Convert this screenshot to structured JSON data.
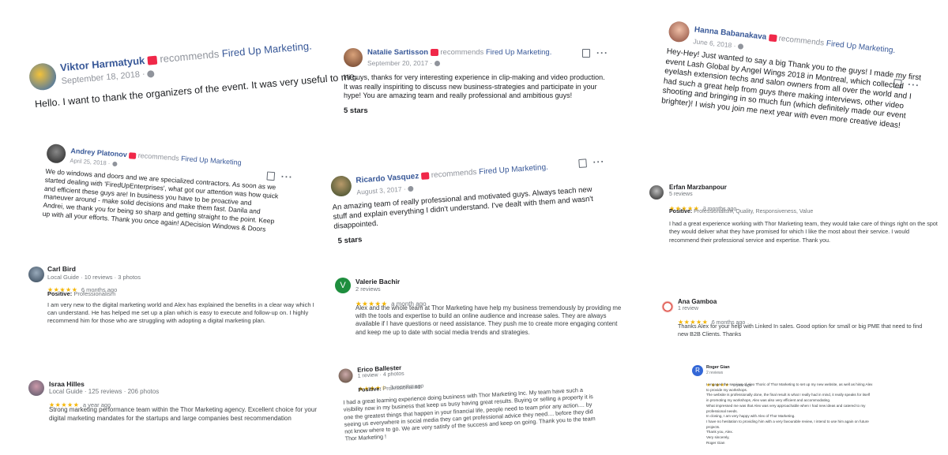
{
  "recommends_label": "recommends",
  "page_name": "Fired Up Marketing.",
  "page_name_plain": "Fired Up Marketing",
  "positive_label": "Positive:",
  "fb_reviews": {
    "viktor": {
      "name": "Viktor Harmatyuk",
      "date": "September 18, 2018 ·",
      "text": "Hello. I want to thank the organizers of the event. It was very useful to me."
    },
    "natalie": {
      "name": "Natalie Sartisson",
      "date": "September 20, 2017 ·",
      "text": "Hi guys, thanks for very interesting experience in clip-making and video production. It was really inspiriting to discuss new business-strategies and participate in your hype! You are amazing team and really professional and ambitious guys!",
      "rating": "5 stars"
    },
    "hanna": {
      "name": "Hanna Babanakava",
      "date": "June 6, 2018 ·",
      "text": "Hey-Hey! Just wanted to say a big Thank you to the guys! I made my first event Lash Global by Angel Wings 2018 in Montreal, which collected eyelash extension techs and salon owners from all over the world and I had such a great help from guys there making interviews, other video shooting and bringing in so much fun (which definitely made our event brighter)! I wish you join me next year with even more creative ideas!"
    },
    "andrey": {
      "name": "Andrey Platonov",
      "date": "April 25, 2018 ·",
      "text": "We do windows and doors and we are specialized contractors. As soon as we started dealing with 'FiredUpEnterprises', what got our attention was how quick and efficient these guys are! In business you have to be proactive and maneuver around - make solid decisions and make them fast. Danila and Andrei, we thank you for being so sharp and getting straight to the point. Keep up with all your efforts. Thank you once again! ADecision Windows & Doors"
    },
    "ricardo": {
      "name": "Ricardo Vasquez",
      "date": "August 3, 2017 ·",
      "text": "An amazing team of really professional and motivated guys. Always teach new stuff and explain everything I didn't understand. I've dealt with them and wasn't disappointed.",
      "rating": "5 stars"
    }
  },
  "google_reviews": {
    "carl": {
      "name": "Carl Bird",
      "meta": "Local Guide · 10 reviews · 3 photos",
      "stars": "★★★★★",
      "when": "6 months ago",
      "positive": "Professionalism",
      "text": "I am very new to the digital marketing world and Alex has explained the benefits in a clear way which I can understand. He has helped me set up a plan which is easy to execute and follow-up on. I highly recommend him for those who are struggling with adopting a digital marketing plan."
    },
    "israa": {
      "name": "Israa Hilles",
      "meta": "Local Guide · 125 reviews · 206 photos",
      "stars": "★★★★★",
      "when": "a year ago",
      "text": "Strong marketing performance team within the Thor Marketing agency.  Excellent choice for your digital marketing mandates for the startups and large companies  best recommendation"
    },
    "valerie": {
      "name": "Valerie Bachir",
      "initial": "V",
      "meta": "2 reviews",
      "stars": "★★★★★",
      "when": "a month ago",
      "text": "Alex and the whole team at Thor Marketing have help my business tremendously by providing me with the tools and expertise to build an online audience and increase sales. They are always available if I have questions or need assistance. They push me to create more engaging content and keep me up to date with social media trends and strategies."
    },
    "erico": {
      "name": "Erico Ballester",
      "meta": "1 review · 4 photos",
      "stars": "★★★★☆",
      "when": "3 months ago",
      "positive": "Professionalism",
      "text": "I had a great learning experience doing business with Thor Marketing Inc. My team have such a visibility now in my business that keep us busy having great results.  Buying or selling a property it is one the greatest things that happen in your financial life, people need to team prior any action.... by seeing us everywhere in social media they can get professional advice they need.... before they did not know where to go.   We are very satisfy of the success and keep on going.  Thank you to the team Thor Marketing !"
    },
    "erfan": {
      "name": "Erfan Marzbanpour",
      "meta": "5 reviews",
      "stars": "★★★★★",
      "when": "3 months ago",
      "positive": "Professionalism, Quality, Responsiveness, Value",
      "text": "I had a great experience working with Thor Marketing team, they would take care of things right on the spot they would deliver what they have promised for which I like the most about their service. I would recommend their professional service and expertise. Thank you."
    },
    "ana": {
      "name": "Ana Gamboa",
      "meta": "1 review",
      "stars": "★★★★★",
      "when": "6 months ago",
      "text": "Thanks Alex for your help with Linked In sales. Good option for small or big PME that need to find new B2B Clients. Thanks"
    },
    "roger": {
      "name": "Roger Gian",
      "initial": "R",
      "meta": "2 reviews",
      "stars": "★★★★★",
      "when": "a year ago",
      "lines": [
        "I engaged the services of Alex Thoric of Thor Marketing to set up my new website, as well as hiring Alex",
        "to provide my workshops.",
        "The website is professionally done, the final result is what I really had in mind, it really speaks for itself",
        "in promoting my workshops, Alex was also very efficient and accommodating.",
        "What impressed me was that Alex was very approachable when I had new ideas and catered to my",
        "professional needs.",
        "In closing, I am very happy with Alex of Thor Marketing.",
        "I have no hesitation to providing him with a very favourable review, I intend to use him again on future",
        "projects.",
        "Thank you, Alex.",
        "Very sincerely,",
        "Roger Gian"
      ]
    }
  },
  "colors": {
    "fb_name": "#385898",
    "fb_muted": "#90949c",
    "star": "#f4b400",
    "badge": "#f02849"
  }
}
